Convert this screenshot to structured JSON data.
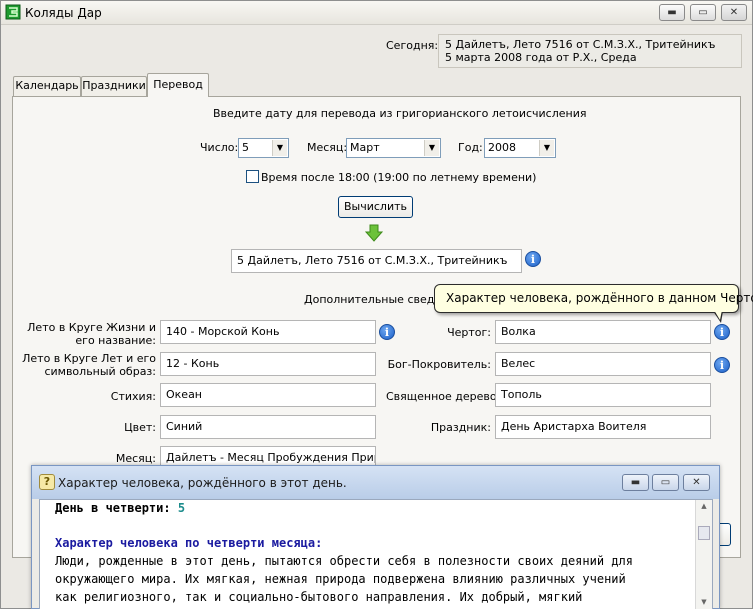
{
  "window": {
    "title": "Коляды Дар",
    "controls": {
      "minimize": "▬",
      "maximize": "▭",
      "close": "✕"
    }
  },
  "today": {
    "label": "Сегодня:",
    "line1": "5 Дайлетъ, Лето 7516 от С.М.З.Х., Тритейникъ",
    "line2": "5 марта 2008 года от Р.Х., Среда"
  },
  "tabs": [
    {
      "label": "Календарь"
    },
    {
      "label": "Праздники"
    },
    {
      "label": "Перевод",
      "active": true
    }
  ],
  "conversion": {
    "prompt": "Введите дату для перевода из григорианского летоисчисления",
    "day_label": "Число:",
    "day_value": "5",
    "month_label": "Месяц:",
    "month_value": "Март",
    "year_label": "Год:",
    "year_value": "2008",
    "checkbox_label": "Время после 18:00 (19:00 по летнему времени)",
    "checkbox_checked": false,
    "calc_button": "Вычислить",
    "result": "5 Дайлетъ, Лето 7516 от С.М.З.Х., Тритейникъ"
  },
  "extra": {
    "heading": "Дополнительные сведени",
    "left": [
      {
        "label": "Лето в Круге Жизни и его название:",
        "value": "140 - Морской Конь",
        "has_info": true
      },
      {
        "label": "Лето в Круге Лет и его символьный образ:",
        "value": "12 - Конь",
        "has_info": false
      },
      {
        "label": "Стихия:",
        "value": "Океан",
        "has_info": false
      },
      {
        "label": "Цвет:",
        "value": "Синий",
        "has_info": false
      },
      {
        "label": "Месяц:",
        "value": "Дайлетъ - Месяц Пробуждения Природы",
        "has_info": false
      }
    ],
    "right": [
      {
        "label": "Чертог:",
        "value": "Волка",
        "has_info": true
      },
      {
        "label": "Бог-Покровитель:",
        "value": "Велес",
        "has_info": true
      },
      {
        "label": "Священное дерево:",
        "value": "Тополь",
        "has_info": false
      },
      {
        "label": "Праздник:",
        "value": "День Аристарха Воителя",
        "has_info": false
      }
    ]
  },
  "tooltip": "Характер человека, рождённого в данном Чертоге.",
  "info_glyph": "i",
  "popup": {
    "title": "Характер человека, рождённого в этот день.",
    "icon_glyph": "?",
    "quarter_label": "День в четверти:",
    "quarter_value": "5",
    "heading": "Характер человека по четверти месяца:",
    "lines": [
      "Люди, рожденные в этот день, пытаются обрести себя в полезности своих деяний для",
      "окружающего мира. Их мягкая, нежная природа подвержена влиянию различных учений",
      "как религиозного, так и социально-бытового направления. Их добрый, мягкий"
    ]
  },
  "colors": {
    "popup_heading": "#1a1aa0",
    "quarter_value": "#1c8c8c",
    "link_blue": "#1a5fc8"
  }
}
